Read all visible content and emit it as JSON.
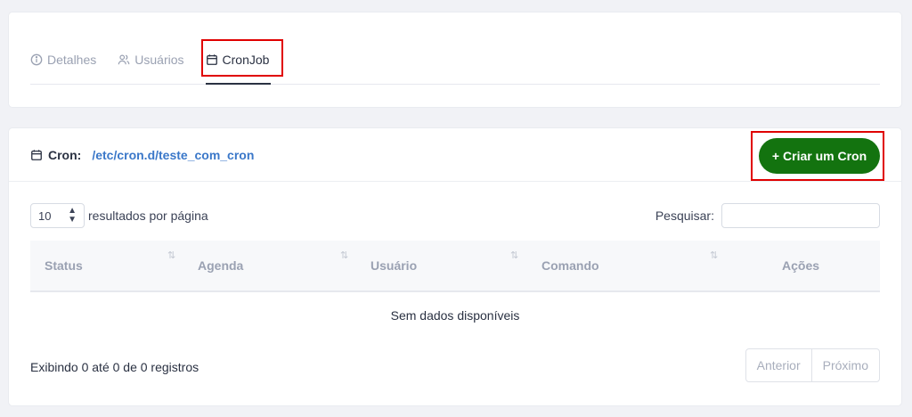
{
  "tabs": [
    {
      "label": "Detalhes",
      "icon": "info-icon"
    },
    {
      "label": "Usuários",
      "icon": "users-icon"
    },
    {
      "label": "CronJob",
      "icon": "calendar-icon"
    }
  ],
  "cron": {
    "label": "Cron:",
    "path": "/etc/cron.d/teste_com_cron",
    "create_label": "Criar um Cron"
  },
  "table_controls": {
    "page_size": "10",
    "page_size_suffix": "resultados por página",
    "search_label": "Pesquisar:",
    "search_placeholder": ""
  },
  "table": {
    "columns": [
      "Status",
      "Agenda",
      "Usuário",
      "Comando",
      "Ações"
    ],
    "empty_text": "Sem dados disponíveis",
    "info": "Exibindo 0 até 0 de 0 registros"
  },
  "pagination": {
    "prev_label": "Anterior",
    "next_label": "Próximo"
  },
  "colors": {
    "accent_green": "#13730f",
    "link_blue": "#3b78c9",
    "highlight_red": "#e00000"
  }
}
